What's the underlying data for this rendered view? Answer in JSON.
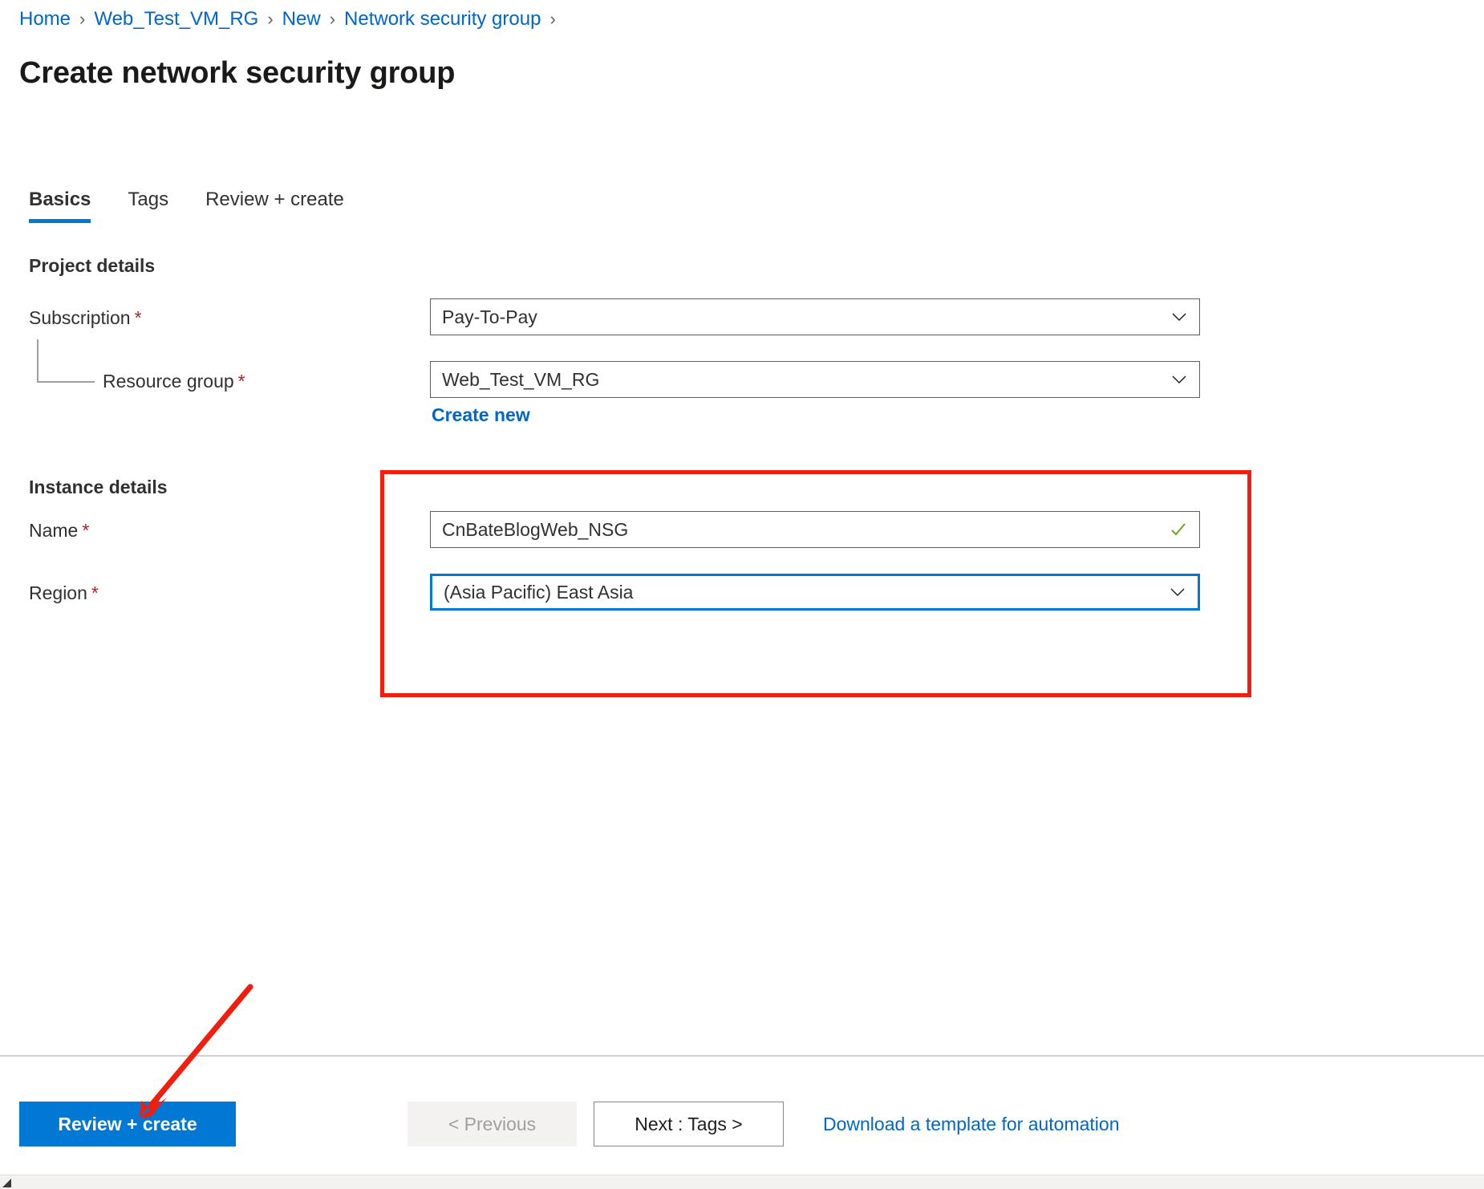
{
  "breadcrumb": {
    "separator": "›",
    "items": [
      {
        "label": "Home"
      },
      {
        "label": "Web_Test_VM_RG"
      },
      {
        "label": "New"
      },
      {
        "label": "Network security group"
      }
    ]
  },
  "page": {
    "title": "Create network security group"
  },
  "tabs": [
    {
      "label": "Basics",
      "active": true
    },
    {
      "label": "Tags",
      "active": false
    },
    {
      "label": "Review + create",
      "active": false
    }
  ],
  "sections": {
    "project_details": {
      "heading": "Project details",
      "subscription": {
        "label": "Subscription",
        "required_marker": "*",
        "value": "Pay-To-Pay"
      },
      "resource_group": {
        "label": "Resource group",
        "required_marker": "*",
        "value": "Web_Test_VM_RG",
        "create_new_label": "Create new"
      }
    },
    "instance_details": {
      "heading": "Instance details",
      "name": {
        "label": "Name",
        "required_marker": "*",
        "value": "CnBateBlogWeb_NSG",
        "validation_icon": "checkmark-icon"
      },
      "region": {
        "label": "Region",
        "required_marker": "*",
        "value": "(Asia Pacific) East Asia"
      }
    }
  },
  "footer": {
    "review_create_label": "Review + create",
    "previous_label": "< Previous",
    "next_label": "Next : Tags >",
    "download_template_label": "Download a template for automation"
  },
  "annotations": {
    "highlight_box_color": "#f21d0d",
    "arrow_color": "#f21d0d"
  },
  "colors": {
    "accent": "#0078d4",
    "link": "#0066cc",
    "required": "#a4262c",
    "valid": "#6aa818"
  }
}
